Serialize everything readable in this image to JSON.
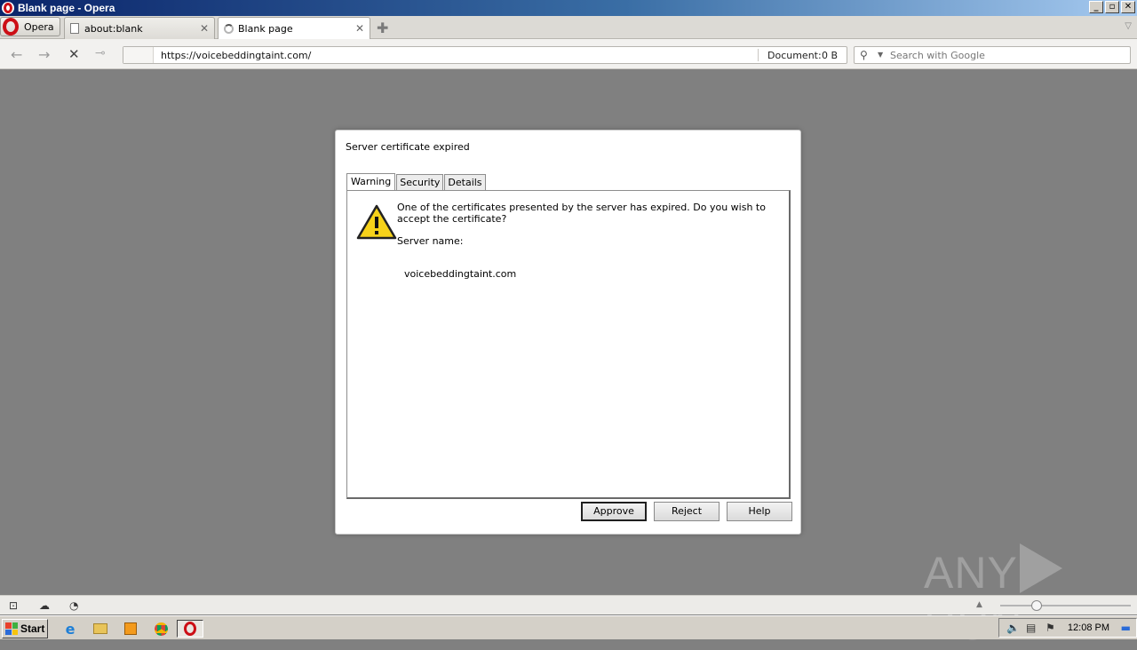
{
  "window": {
    "title": "Blank page - Opera",
    "min": "_",
    "max": "▫",
    "close": "✕"
  },
  "menu": {
    "label": "Opera"
  },
  "tabs": [
    {
      "label": "about:blank",
      "active": false
    },
    {
      "label": "Blank page",
      "active": true
    }
  ],
  "toolbar": {
    "url": "https://voicebeddingtaint.com/",
    "doc_label": "Document:",
    "doc_value": "0 B",
    "search_placeholder": "Search with Google"
  },
  "dialog": {
    "title": "Server certificate expired",
    "tabs": [
      "Warning",
      "Security",
      "Details"
    ],
    "message": "One of the certificates presented by the server has expired. Do you wish to accept the certificate?",
    "server_label": "Server name:",
    "server_name": "voicebeddingtaint.com",
    "buttons": {
      "approve": "Approve",
      "reject": "Reject",
      "help": "Help"
    }
  },
  "taskbar": {
    "start_label": "Start",
    "clock": "12:08 PM"
  },
  "watermark": {
    "left": "ANY",
    "right": "RUN"
  },
  "icons": {
    "back": "back-arrow-icon",
    "forward": "forward-arrow-icon",
    "stop": "stop-icon",
    "key": "key-icon",
    "search": "magnifier-icon",
    "warning": "warning-triangle-icon"
  },
  "colors": {
    "page_bg": "#808080",
    "opera_red": "#cc0f16",
    "titlebar": "#0a246a"
  }
}
